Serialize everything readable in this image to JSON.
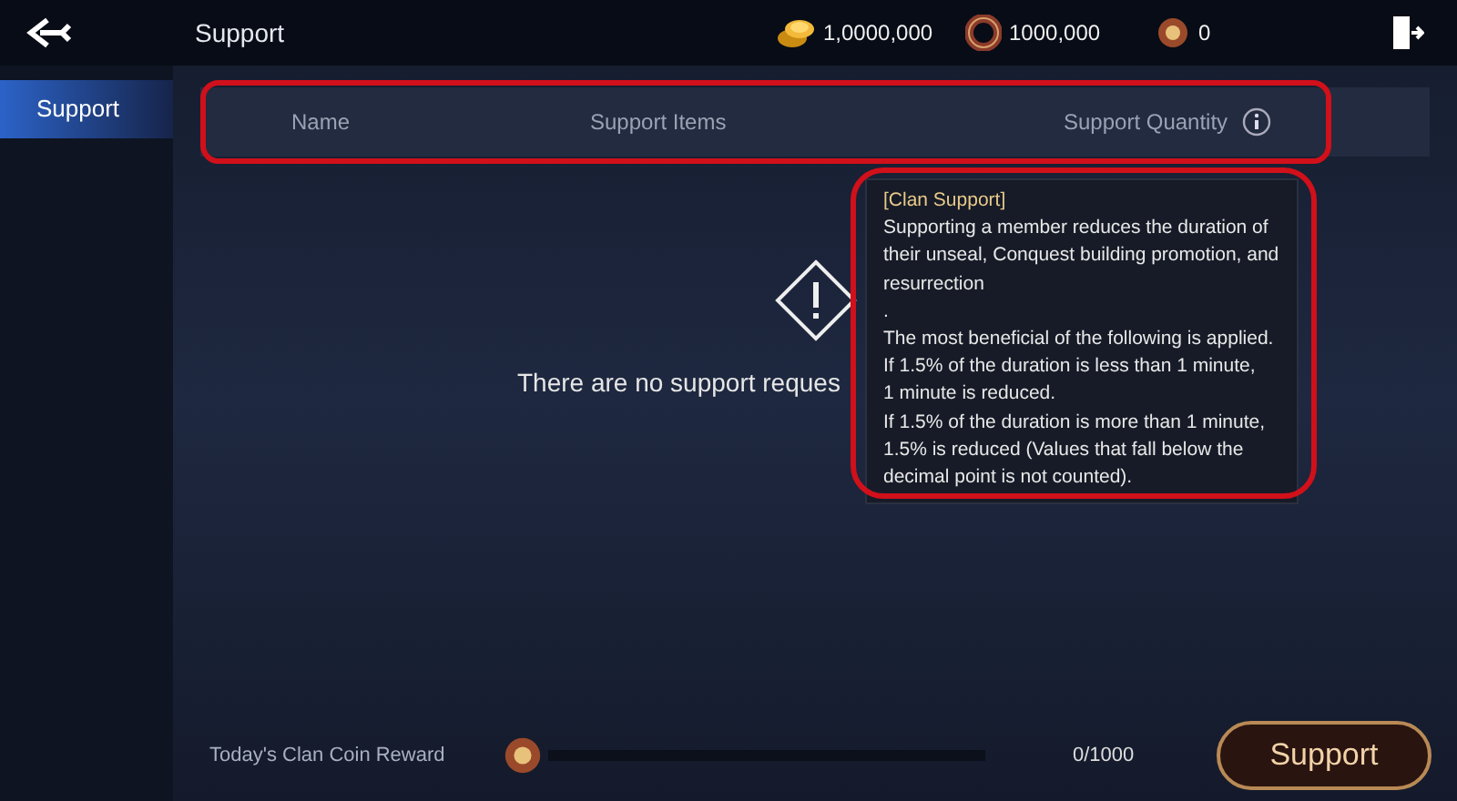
{
  "top_bar": {
    "title": "Support",
    "currencies": [
      {
        "amount": "1,0000,000",
        "kind": "gold"
      },
      {
        "amount": "1000,000",
        "kind": "ring"
      },
      {
        "amount": "0",
        "kind": "clan"
      }
    ]
  },
  "sidebar": {
    "items": [
      {
        "label": "Support",
        "selected": true
      }
    ]
  },
  "table": {
    "columns": [
      "Name",
      "Support Items",
      "Support Quantity"
    ]
  },
  "empty_message": "There are no support reques",
  "tooltip": {
    "title": "[Clan Support]",
    "lines": [
      "Supporting a member reduces the duration of",
      "their unseal, Conquest building promotion, and",
      "resurrection",
      ".",
      "The most beneficial of the following is applied.",
      "If 1.5% of the duration is less than 1 minute,",
      "1 minute is reduced.",
      "If 1.5% of the duration is more than 1 minute,",
      "1.5% is reduced (Values that fall below the",
      "decimal point is not counted)."
    ]
  },
  "footer": {
    "label": "Today's Clan Coin Reward",
    "level": 0,
    "reading": "0/1000",
    "button": "Support"
  }
}
